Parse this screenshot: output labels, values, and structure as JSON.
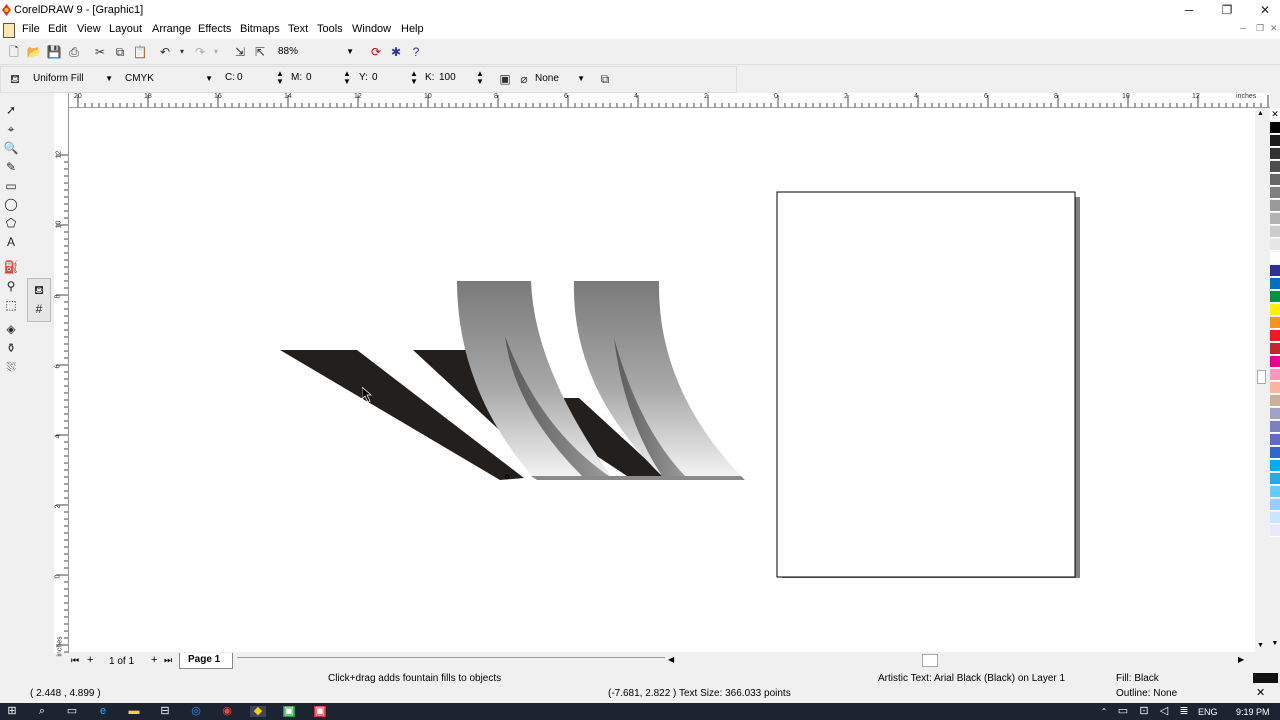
{
  "window": {
    "title": "CorelDRAW 9 - [Graphic1]",
    "controls": [
      "minimize",
      "restore",
      "close"
    ]
  },
  "menu": [
    "File",
    "Edit",
    "View",
    "Layout",
    "Arrange",
    "Effects",
    "Bitmaps",
    "Text",
    "Tools",
    "Window",
    "Help"
  ],
  "toolbar": {
    "zoom": "88%"
  },
  "property_bar": {
    "fill_type": "Uniform Fill",
    "color_model": "CMYK",
    "c_label": "C:",
    "c_value": "0",
    "m_label": "M:",
    "m_value": "0",
    "y_label": "Y:",
    "y_value": "0",
    "k_label": "K:",
    "k_value": "100",
    "outline": "None"
  },
  "rulers": {
    "unit": "inches",
    "top_ticks": [
      "20",
      "18",
      "16",
      "14",
      "12",
      "10",
      "8",
      "6",
      "4",
      "2",
      "0",
      "2",
      "4",
      "6",
      "8",
      "10",
      "12"
    ],
    "left_ticks": [
      "12",
      "10",
      "8",
      "6",
      "4",
      "2",
      "0"
    ],
    "left_unit": "inches"
  },
  "pages": {
    "counter": "1 of 1",
    "tab": "Page 1"
  },
  "status": {
    "coords": "( 2.448 , 4.899 )",
    "hint": "Click+drag adds fountain fills to objects",
    "cursor_info": "(-7.681, 2.822 )  Text Size: 366.033 points",
    "object": "Artistic Text: Arial Black (Black) on Layer 1",
    "fill": "Fill: Black",
    "outline": "Outline: None"
  },
  "taskbar": {
    "language": "ENG",
    "time": "9:19 PM"
  },
  "colors": {
    "palette": [
      "#000000",
      "#1a1a1a",
      "#333333",
      "#4d4d4d",
      "#666666",
      "#808080",
      "#999999",
      "#b3b3b3",
      "#cccccc",
      "#e6e6e6",
      "#ffffff",
      "#2e3192",
      "#0071bc",
      "#009245",
      "#fff200",
      "#f7941d",
      "#ed1c24",
      "#c1272d",
      "#ec008c",
      "#f49ac1",
      "#fbb4a0",
      "#c7b299",
      "#a0a0c8",
      "#7f7fbf",
      "#6666cc",
      "#3366cc",
      "#00aeef",
      "#29abe2",
      "#66ccff",
      "#99ccff",
      "#cce5ff",
      "#e8e8ff"
    ]
  }
}
